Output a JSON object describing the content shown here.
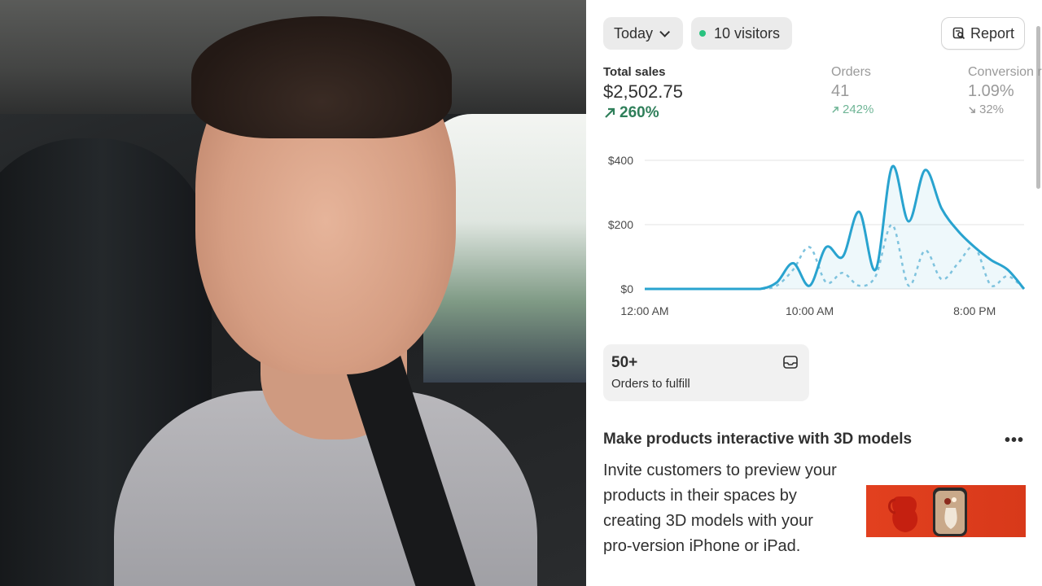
{
  "dashboard": {
    "date_filter": "Today",
    "visitors": "10 visitors",
    "report_button": "Report",
    "metrics": {
      "total_sales": {
        "label": "Total sales",
        "value": "$2,502.75",
        "delta": "260%"
      },
      "orders": {
        "label": "Orders",
        "value": "41",
        "delta": "242%"
      },
      "conversion": {
        "label": "Conversion r",
        "value": "1.09%",
        "delta": "32%"
      }
    },
    "orders_card": {
      "count": "50+",
      "label": "Orders to fulfill"
    },
    "promo": {
      "title": "Make products interactive with 3D models",
      "body": "Invite customers to preview your products in their spaces by creating 3D models with your pro-version iPhone or iPad."
    }
  },
  "colors": {
    "accent": "#29a3cf",
    "positive": "#2f7f5a",
    "dot_live": "#29c27f"
  },
  "chart_data": {
    "type": "line",
    "x_tick_labels": [
      "12:00 AM",
      "10:00 AM",
      "8:00 PM"
    ],
    "y_tick_labels": [
      "$400",
      "$200",
      "$0"
    ],
    "ylim": [
      0,
      400
    ],
    "x_hours": [
      0,
      1,
      2,
      3,
      4,
      5,
      6,
      7,
      8,
      9,
      10,
      11,
      12,
      13,
      14,
      15,
      16,
      17,
      18,
      19,
      20,
      21,
      22,
      23
    ],
    "series": [
      {
        "style": "solid",
        "values": [
          0,
          0,
          0,
          0,
          0,
          0,
          0,
          0,
          20,
          80,
          10,
          130,
          100,
          240,
          60,
          380,
          210,
          370,
          250,
          180,
          130,
          90,
          60,
          0
        ]
      },
      {
        "style": "dashed",
        "values": [
          0,
          0,
          0,
          0,
          0,
          0,
          0,
          0,
          10,
          60,
          130,
          20,
          50,
          10,
          40,
          200,
          10,
          120,
          30,
          80,
          130,
          10,
          40,
          0
        ]
      }
    ],
    "grid": true
  }
}
